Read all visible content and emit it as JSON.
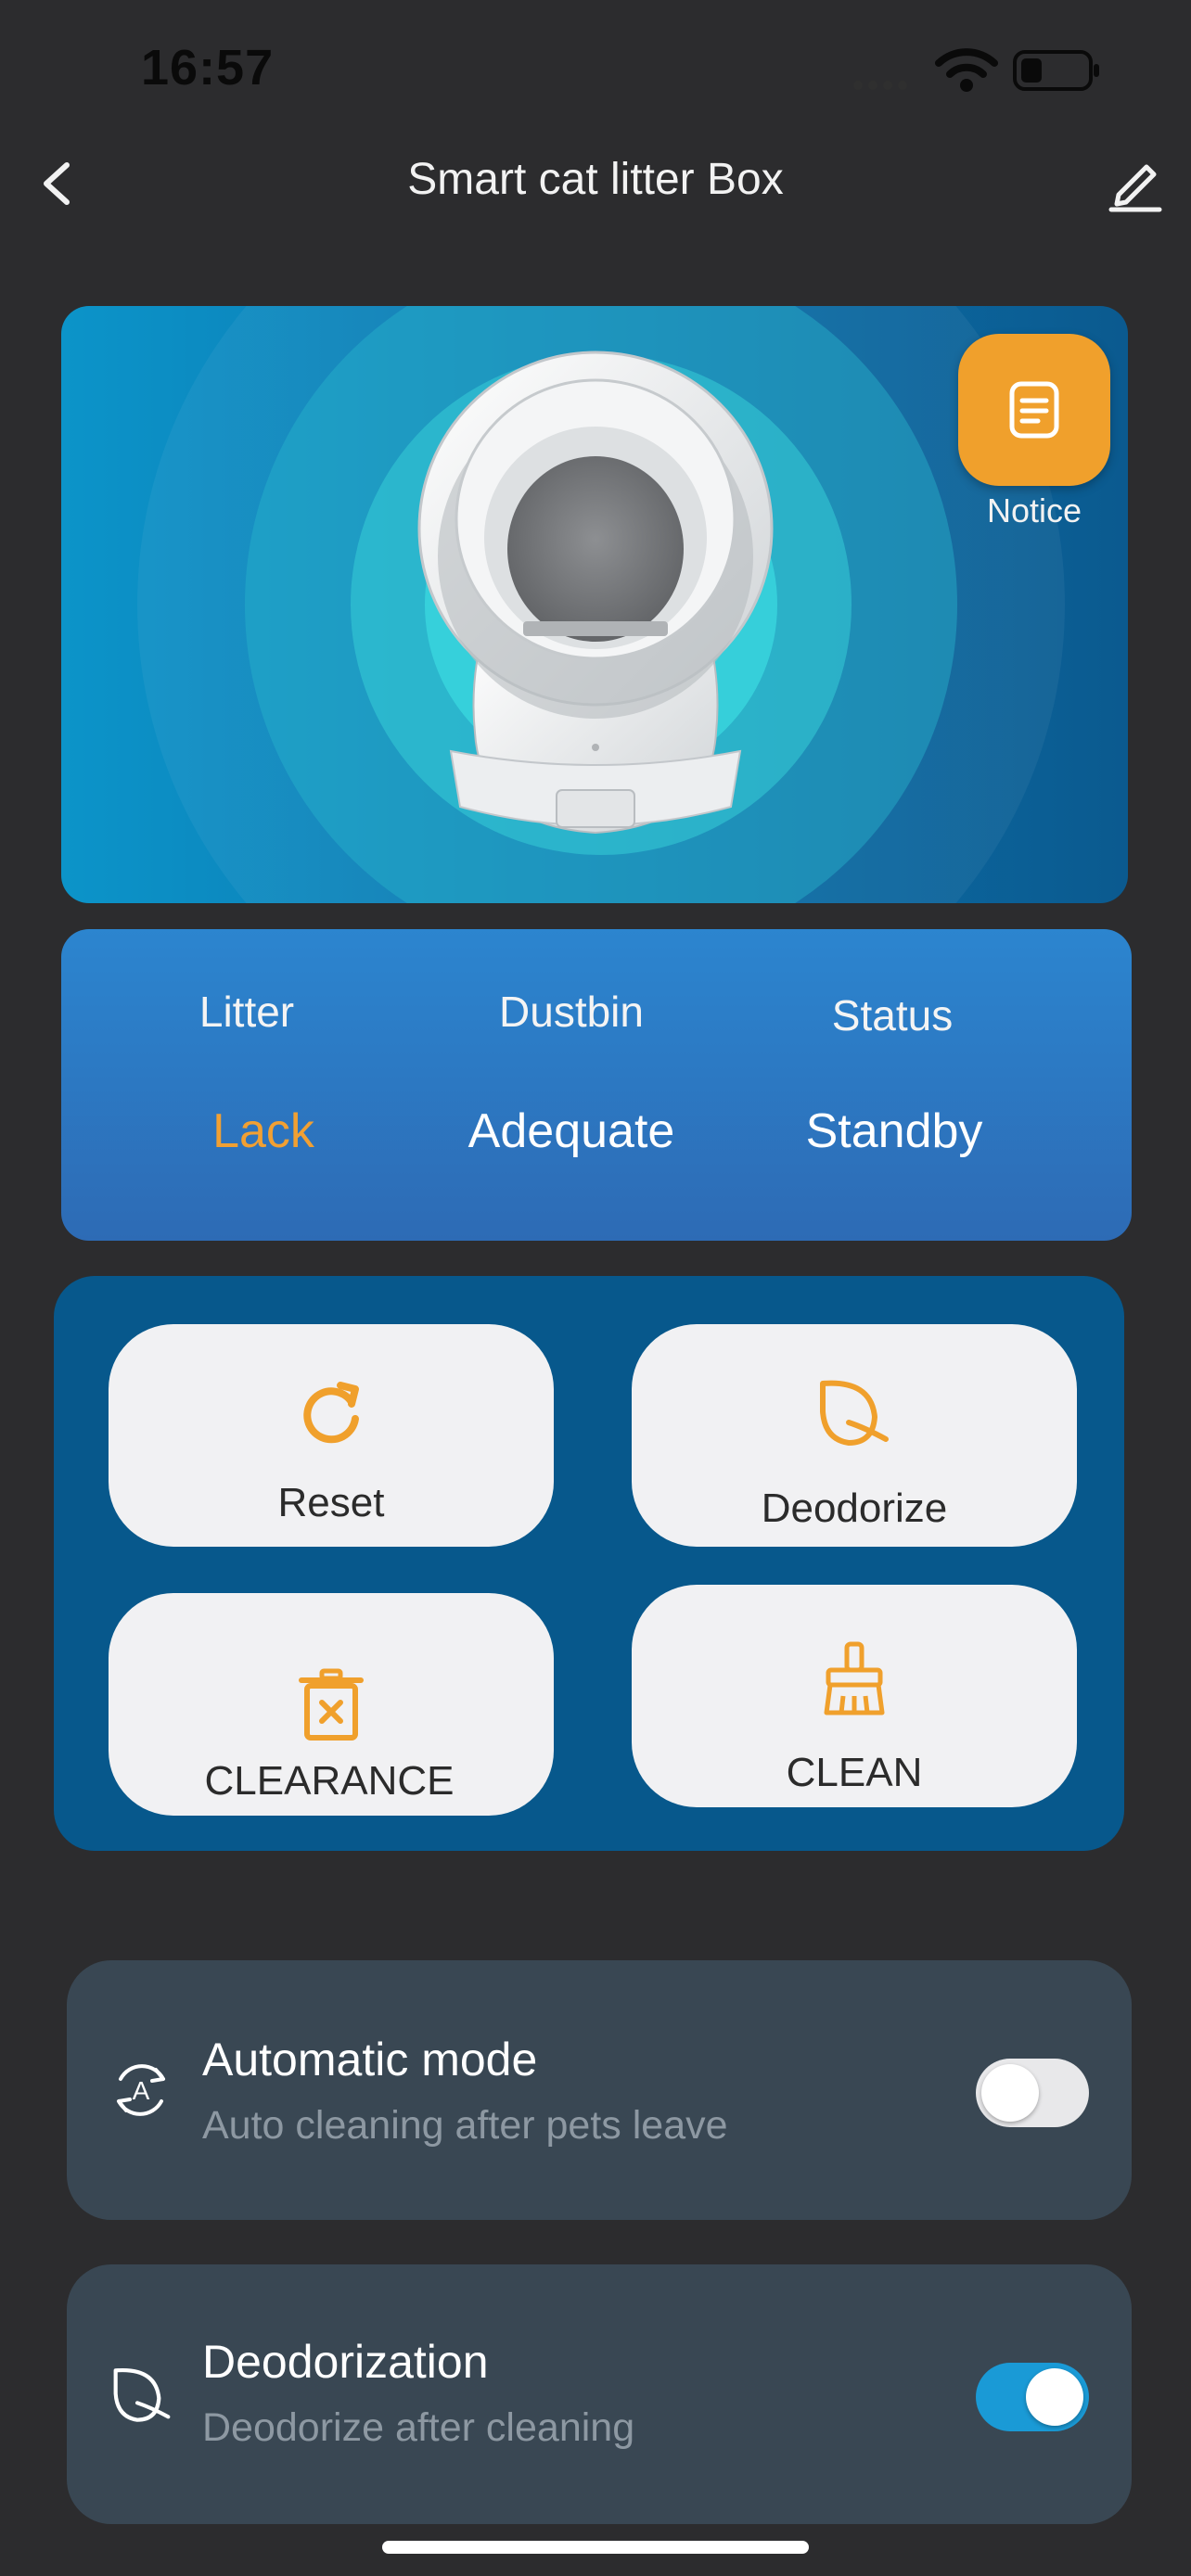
{
  "status_bar": {
    "time": "16:57"
  },
  "header": {
    "title": "Smart cat litter Box"
  },
  "hero": {
    "notice_label": "Notice",
    "colors": {
      "accent": "#f0a02c",
      "bg_start": "#0c94c9",
      "bg_end": "#0b5a8f"
    }
  },
  "status": {
    "litter_label": "Litter",
    "litter_value": "Lack",
    "dustbin_label": "Dustbin",
    "dustbin_value": "Adequate",
    "state_label": "Status",
    "state_value": "Standby",
    "warn_color": "#f1a033"
  },
  "actions": {
    "reset": {
      "label": "Reset",
      "icon": "refresh-icon"
    },
    "deodorize": {
      "label": "Deodorize",
      "icon": "leaf-icon"
    },
    "clearance": {
      "label": "CLEARANCE",
      "icon": "trash-x-icon"
    },
    "clean": {
      "label": "CLEAN",
      "icon": "brush-icon"
    }
  },
  "settings": {
    "automatic": {
      "title": "Automatic mode",
      "subtitle": "Auto cleaning after pets leave",
      "enabled": false,
      "icon": "auto-mode-icon"
    },
    "deodorization": {
      "title": "Deodorization",
      "subtitle": "Deodorize after cleaning",
      "enabled": true,
      "icon": "leaf-icon",
      "on_color": "#1a9ad6"
    }
  }
}
